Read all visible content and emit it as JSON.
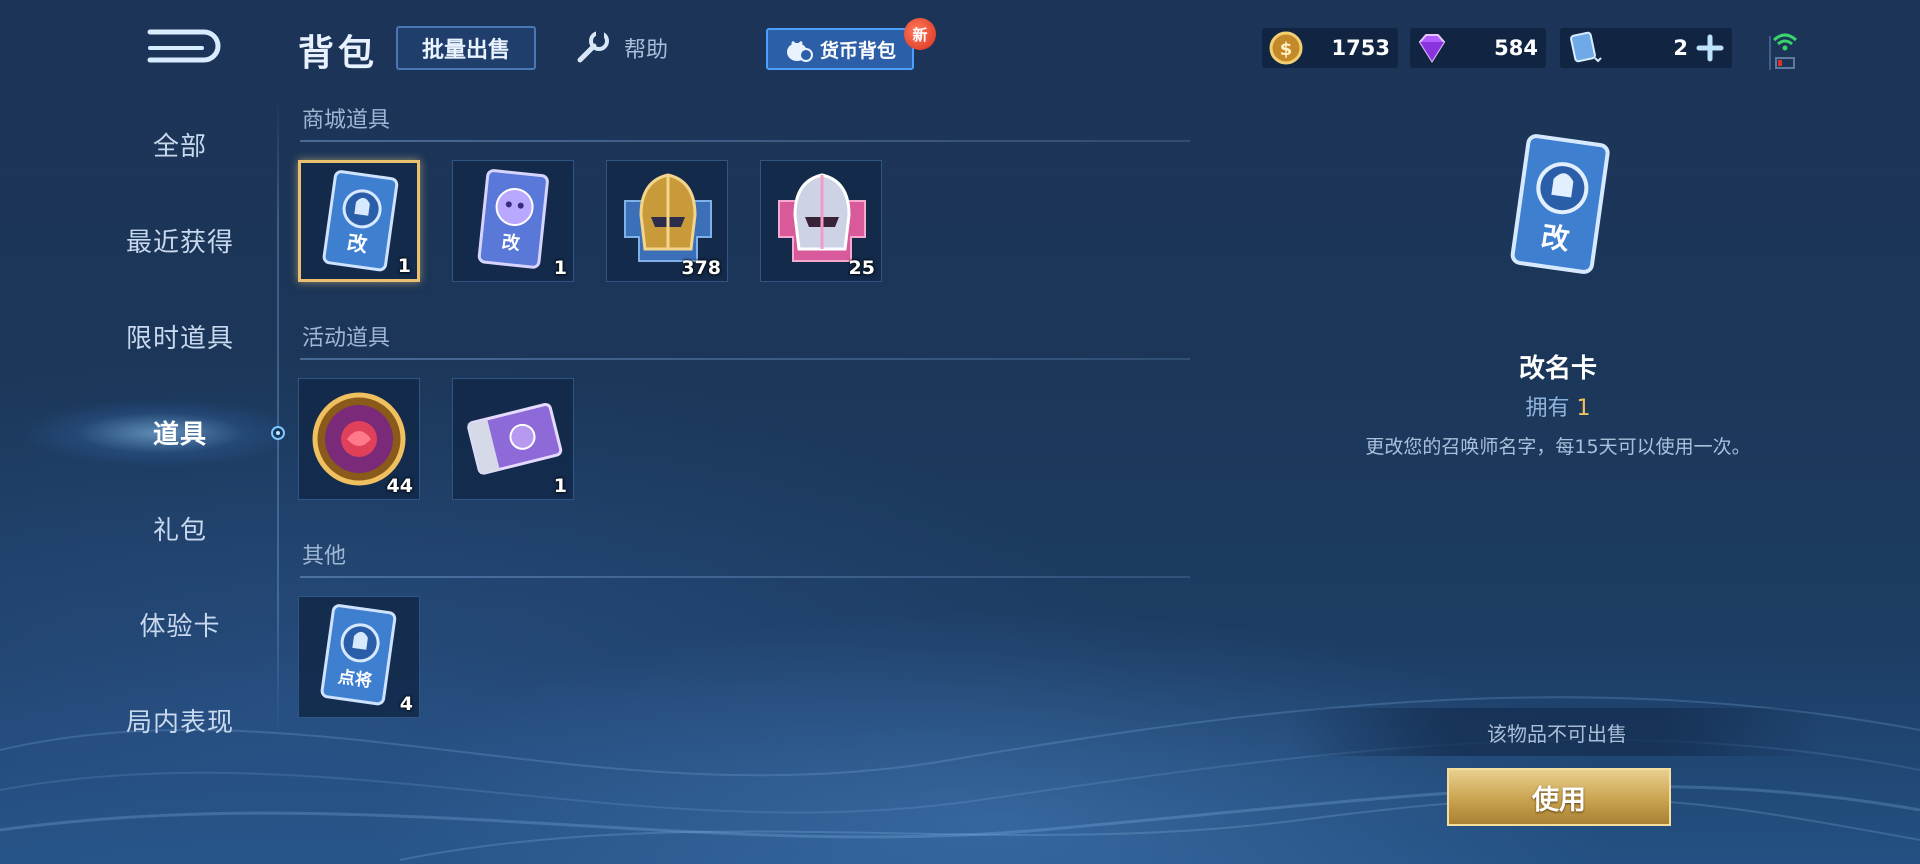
{
  "header": {
    "title": "背包",
    "bulk_sell_label": "批量出售",
    "help_label": "帮助",
    "currency_bag_label": "货币背包",
    "new_badge": "新"
  },
  "resources": {
    "gold": "1753",
    "gems": "584",
    "tickets": "2"
  },
  "sidebar": {
    "items": [
      {
        "label": "全部"
      },
      {
        "label": "最近获得"
      },
      {
        "label": "限时道具"
      },
      {
        "label": "道具"
      },
      {
        "label": "礼包"
      },
      {
        "label": "体验卡"
      },
      {
        "label": "局内表现"
      }
    ],
    "active_index": 3
  },
  "sections": [
    {
      "title": "商城道具",
      "items": [
        {
          "icon": "rename-card-icon",
          "qty": "1"
        },
        {
          "icon": "cute-rename-card-icon",
          "qty": "1"
        },
        {
          "icon": "gold-helmet-fragment-icon",
          "qty": "378"
        },
        {
          "icon": "pink-helmet-fragment-icon",
          "qty": "25"
        }
      ]
    },
    {
      "title": "活动道具",
      "items": [
        {
          "icon": "rose-coin-icon",
          "qty": "44"
        },
        {
          "icon": "purple-ticket-icon",
          "qty": "1"
        }
      ]
    },
    {
      "title": "其他",
      "items": [
        {
          "icon": "hero-pick-card-icon",
          "qty": "4"
        }
      ]
    }
  ],
  "detail": {
    "name": "改名卡",
    "owned_label": "拥有",
    "owned_count": "1",
    "description": "更改您的召唤师名字，每15天可以使用一次。",
    "not_sellable": "该物品不可出售",
    "use_label": "使用"
  },
  "card_text": {
    "rename": "改",
    "hero_pick": "点将"
  },
  "colors": {
    "accent_gold": "#f1c15a",
    "selected_border": "#e8c070",
    "currency_bag_bg": "#2c5fa8"
  }
}
